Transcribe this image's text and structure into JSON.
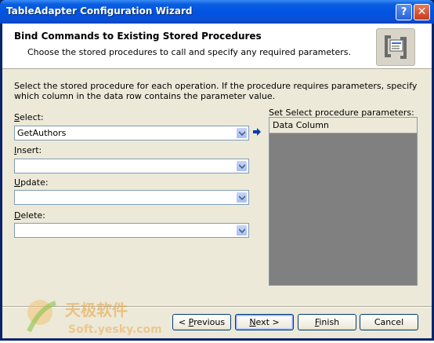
{
  "window": {
    "title": "TableAdapter Configuration Wizard",
    "help_label": "?",
    "close_label": "✕"
  },
  "header": {
    "title": "Bind Commands to Existing Stored Procedures",
    "subtitle": "Choose the stored procedures to call and specify any required parameters."
  },
  "description": "Select the stored procedure for each operation. If the procedure requires parameters, specify which column in the data row contains the parameter value.",
  "fields": {
    "select": {
      "label_hot": "S",
      "label_rest": "elect:",
      "value": "GetAuthors"
    },
    "insert": {
      "label_hot": "I",
      "label_rest": "nsert:",
      "value": ""
    },
    "update": {
      "label_hot": "U",
      "label_rest": "pdate:",
      "value": ""
    },
    "delete": {
      "label_hot": "D",
      "label_rest": "elete:",
      "value": ""
    }
  },
  "params": {
    "label": "Set Select procedure parameters:",
    "column_header": "Data Column"
  },
  "watermark": {
    "text1": "天极软件",
    "text2": "Soft.yesky.com"
  },
  "buttons": {
    "previous": {
      "hot": "P",
      "pre": "< ",
      "rest": "revious"
    },
    "next": {
      "hot": "N",
      "pre": "",
      "rest": "ext >"
    },
    "finish": {
      "hot": "F",
      "pre": "",
      "rest": "inish"
    },
    "cancel": "Cancel"
  },
  "colors": {
    "title_bar": "#0054e3",
    "dialog_bg": "#ece9d8",
    "grid_bg": "#808080",
    "arrow": "#0a3ab0"
  }
}
